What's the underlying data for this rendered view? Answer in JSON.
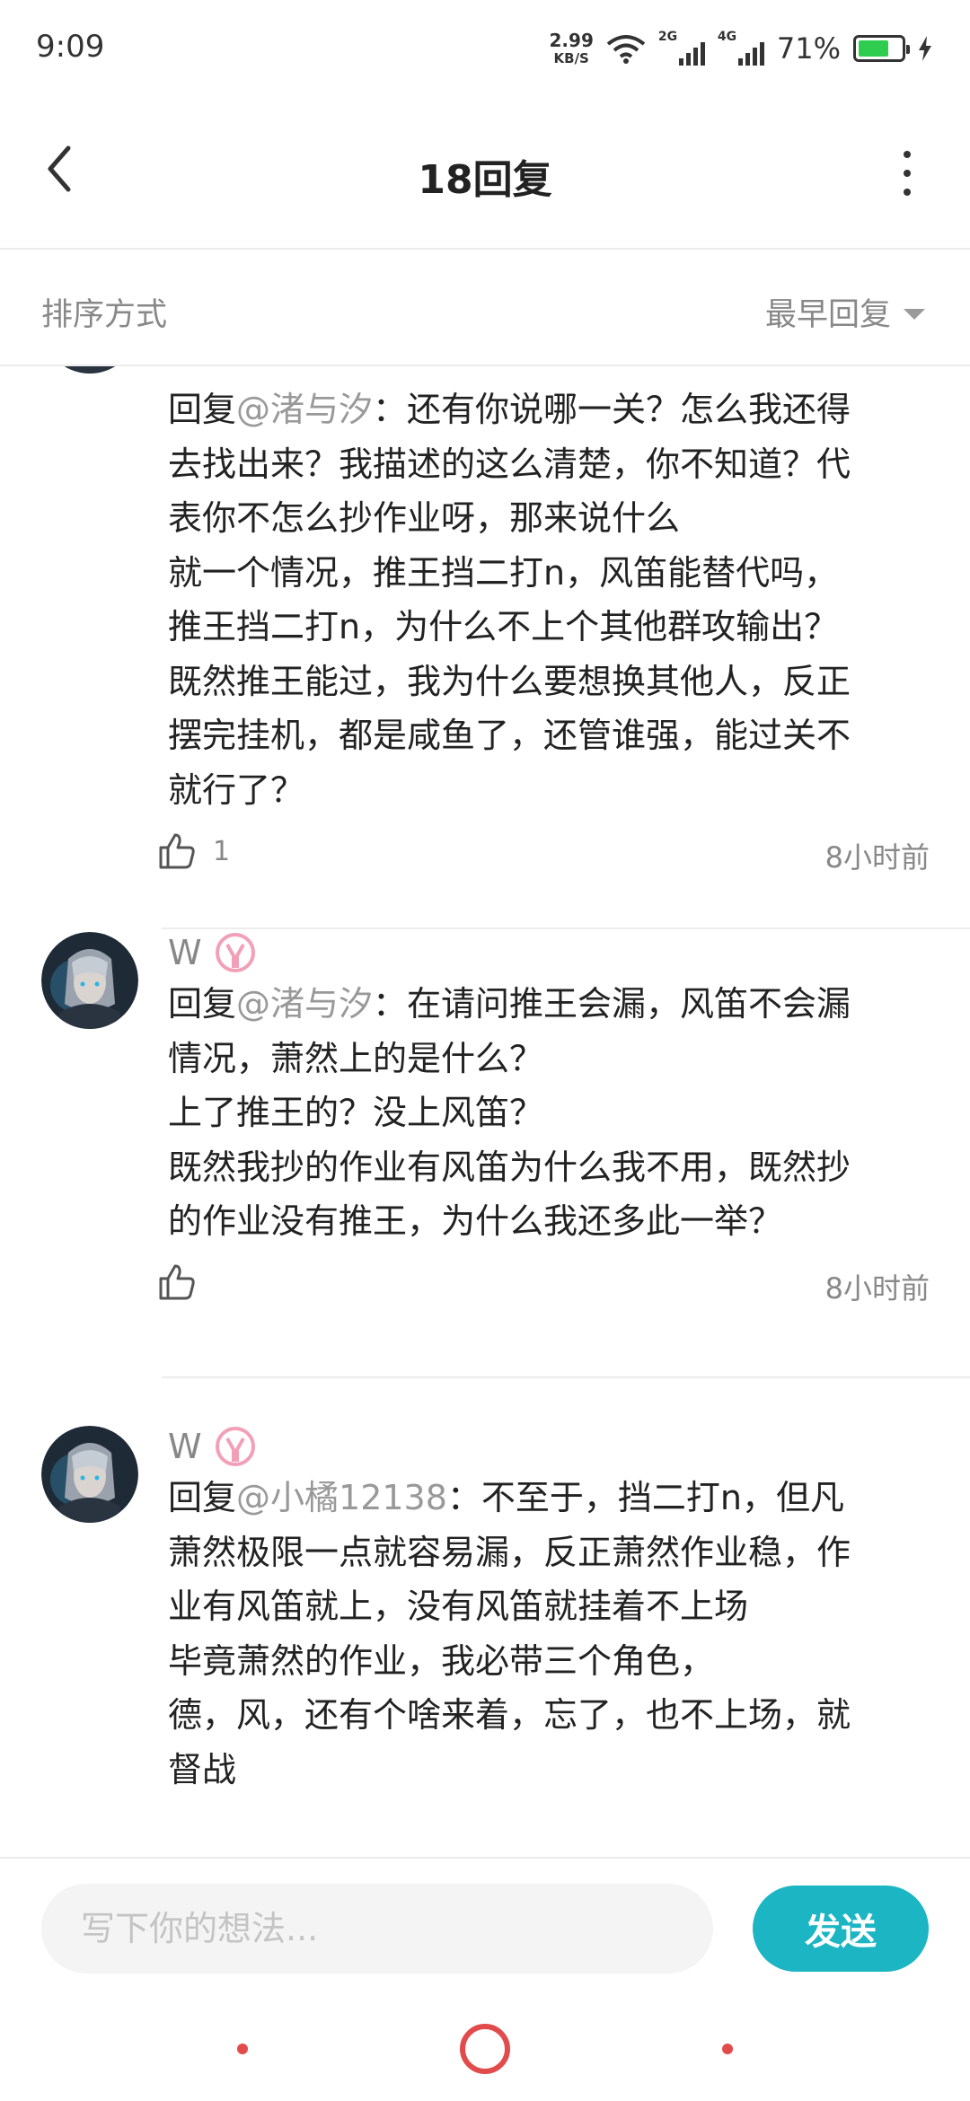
{
  "status_bar": {
    "time": "9:09",
    "net_speed": "2.99",
    "net_unit": "KB/S",
    "sim1": "2G",
    "sim2": "4G",
    "battery_percent": "71%",
    "battery_level": 0.71,
    "battery_color": "#2ecc4f"
  },
  "header": {
    "title": "18回复"
  },
  "sort_bar": {
    "label": "排序方式",
    "selected": "最早回复"
  },
  "comments": [
    {
      "username": "",
      "mention": "@渚与汐",
      "prefix": "回复",
      "lines": [
        "：还有你说哪一关？怎么我还得",
        "去找出来？我描述的这么清楚，你不知道？代",
        "表你不怎么抄作业呀，那来说什么",
        "就一个情况，推王挡二打n，风笛能替代吗，",
        "推王挡二打n，为什么不上个其他群攻输出？",
        "既然推王能过，我为什么要想换其他人，反正",
        "摆完挂机，都是咸鱼了，还管谁强，能过关不",
        "就行了？"
      ],
      "likes": "1",
      "time": "8小时前"
    },
    {
      "username": "W",
      "mention": "@渚与汐",
      "prefix": "回复",
      "lines": [
        "：在请问推王会漏，风笛不会漏",
        "情况，萧然上的是什么？",
        "上了推王的？没上风笛？",
        "既然我抄的作业有风笛为什么我不用，既然抄",
        "的作业没有推王，为什么我还多此一举？"
      ],
      "likes": "",
      "time": "8小时前"
    },
    {
      "username": "W",
      "mention": "@小橘12138",
      "prefix": "回复",
      "lines": [
        "：不至于，挡二打n，但凡",
        "萧然极限一点就容易漏，反正萧然作业稳，作",
        "业有风笛就上，没有风笛就挂着不上场",
        "毕竟萧然的作业，我必带三个角色，",
        "德，风，还有个啥来着，忘了，也不上场，就",
        "督战"
      ]
    }
  ],
  "input_bar": {
    "placeholder": "写下你的想法...",
    "send_label": "发送",
    "accent_color": "#1cb5c4"
  },
  "icons": [
    "back-arrow-icon",
    "more-icon",
    "caret-down-icon",
    "thumbs-up-icon",
    "badge-icon",
    "wifi-icon",
    "signal-icon",
    "battery-icon",
    "charging-icon"
  ]
}
